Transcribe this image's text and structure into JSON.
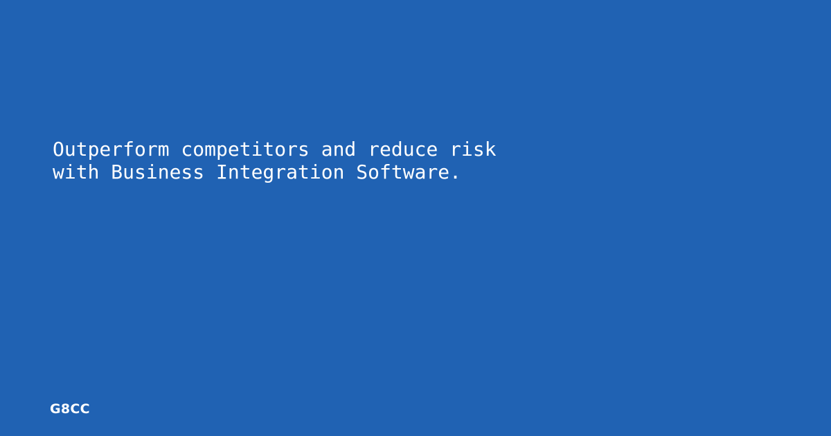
{
  "colors": {
    "background": "#2062b3",
    "text": "#ffffff"
  },
  "headline": {
    "lines": [
      "Outperform competitors and reduce risk",
      "with Business Integration Software."
    ]
  },
  "brand": {
    "name": "G8CC"
  }
}
